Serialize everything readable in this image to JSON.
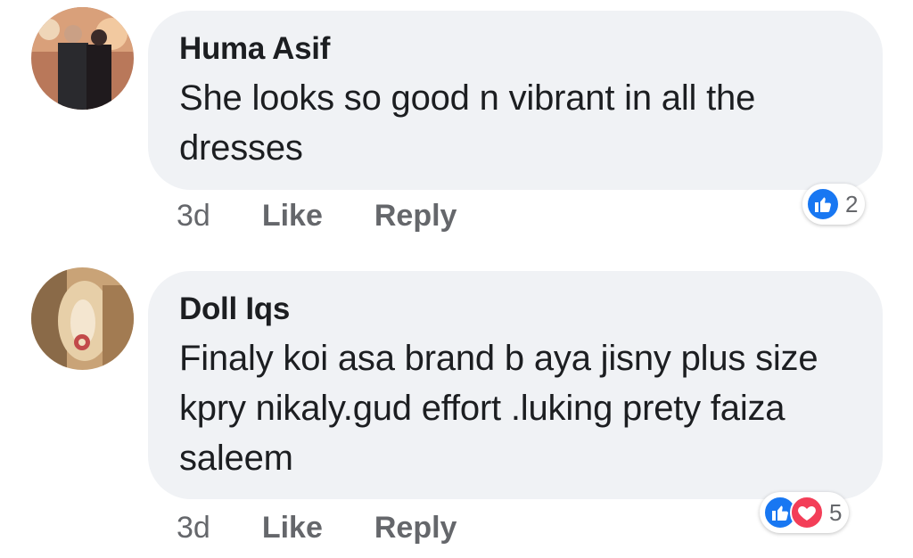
{
  "comments": [
    {
      "author": "Huma Asif",
      "text": "She looks so good n vibrant in all the dresses",
      "time": "3d",
      "like_label": "Like",
      "reply_label": "Reply",
      "reactions": [
        "like-icon"
      ],
      "reaction_count": "2",
      "avatar_icon": "user-photo-icon"
    },
    {
      "author": "Doll Iqs",
      "text": "Finaly koi asa brand b aya jisny plus size kpry nikaly.gud effort .luking prety faiza saleem",
      "time": "3d",
      "like_label": "Like",
      "reply_label": "Reply",
      "reactions": [
        "like-icon",
        "love-icon"
      ],
      "reaction_count": "5",
      "avatar_icon": "user-photo-icon"
    }
  ],
  "colors": {
    "bubble": "#f0f2f5",
    "like_blue": "#1877f2",
    "love_red": "#f33e58",
    "meta_gray": "#65676b"
  }
}
